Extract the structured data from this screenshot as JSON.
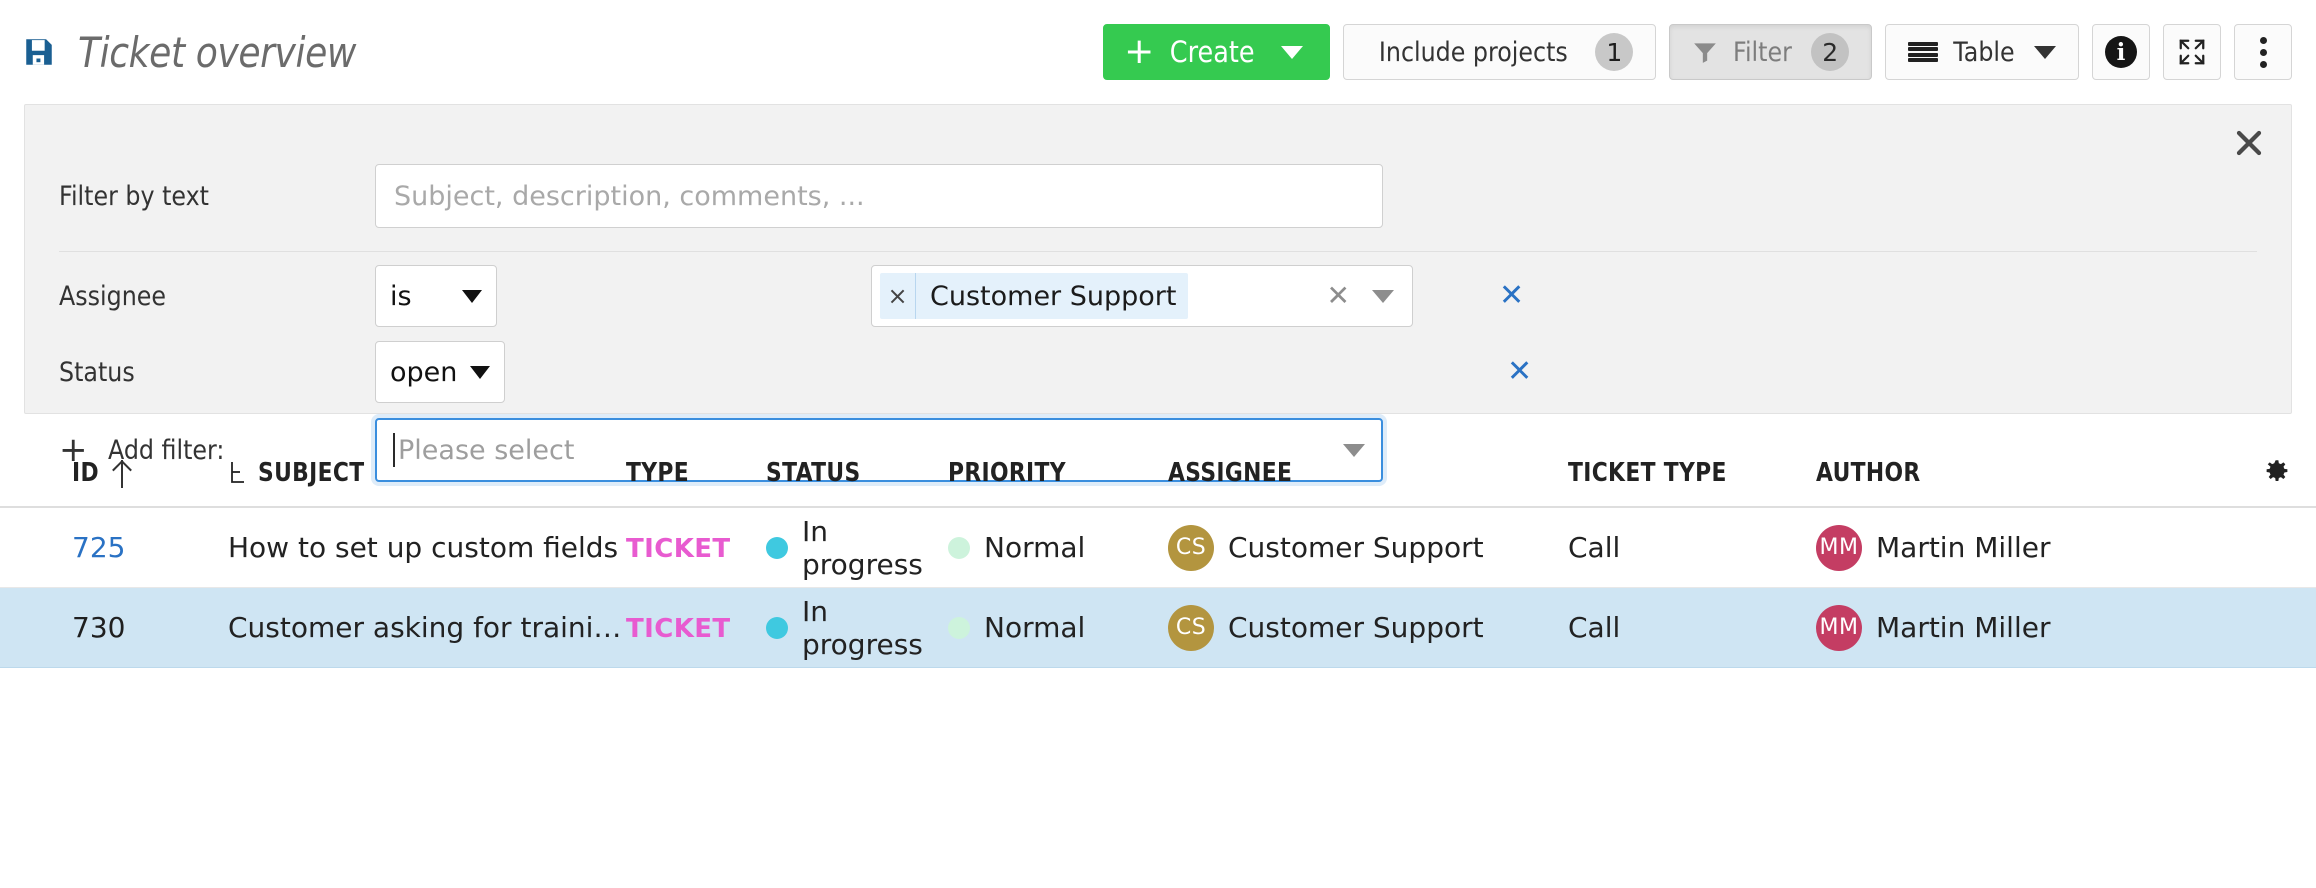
{
  "header": {
    "save_icon": "floppy-disk-icon",
    "title": "Ticket overview",
    "buttons": {
      "create": "Create",
      "include_projects": "Include projects",
      "include_projects_badge": "1",
      "filter": "Filter",
      "filter_badge": "2",
      "table": "Table",
      "info_icon": "info-icon",
      "fullscreen_icon": "fullscreen-icon",
      "more_icon": "kebab-menu-icon"
    }
  },
  "filter_panel": {
    "close_icon": "close-icon",
    "text_filter": {
      "label": "Filter by text",
      "value": "",
      "placeholder": "Subject, description, comments, ..."
    },
    "rows": [
      {
        "label": "Assignee",
        "operator": "is",
        "tokens": [
          "Customer Support"
        ],
        "remove_icon": "remove-filter-icon"
      },
      {
        "label": "Status",
        "operator": "open",
        "remove_icon": "remove-filter-icon"
      }
    ],
    "add_filter": {
      "label": "Add filter:",
      "placeholder": "Please select",
      "value": ""
    }
  },
  "table": {
    "columns": [
      {
        "key": "id",
        "label": "ID",
        "sort": "asc"
      },
      {
        "key": "subject",
        "label": "Subject"
      },
      {
        "key": "type",
        "label": "Type"
      },
      {
        "key": "status",
        "label": "Status"
      },
      {
        "key": "priority",
        "label": "Priority"
      },
      {
        "key": "assignee",
        "label": "Assignee"
      },
      {
        "key": "ticket_type",
        "label": "Ticket type"
      },
      {
        "key": "author",
        "label": "Author"
      }
    ],
    "settings_icon": "table-settings-gear-icon",
    "rows": [
      {
        "id": "725",
        "subject": "How to set up custom fields",
        "type": "TICKET",
        "status": "In progress",
        "priority": "Normal",
        "assignee": "Customer Support",
        "assignee_initials": "CS",
        "ticket_type": "Call",
        "author": "Martin Miller",
        "author_initials": "MM",
        "selected": false
      },
      {
        "id": "730",
        "subject": "Customer asking for training s...",
        "type": "TICKET",
        "status": "In progress",
        "priority": "Normal",
        "assignee": "Customer Support",
        "assignee_initials": "CS",
        "ticket_type": "Call",
        "author": "Martin Miller",
        "author_initials": "MM",
        "selected": true
      }
    ]
  },
  "colors": {
    "create_green": "#35ca50",
    "link_blue": "#2a72c4",
    "type_magenta": "#e85bd0",
    "status_dot": "#3fc9e0",
    "priority_dot": "#cdf3dc",
    "avatar_assignee": "#b3953f",
    "avatar_author": "#c43d63",
    "row_selected": "#cfe5f3",
    "panel_bg": "#f2f2f2",
    "token_bg": "#e4f1fb",
    "focus_border": "#3a8ede"
  }
}
